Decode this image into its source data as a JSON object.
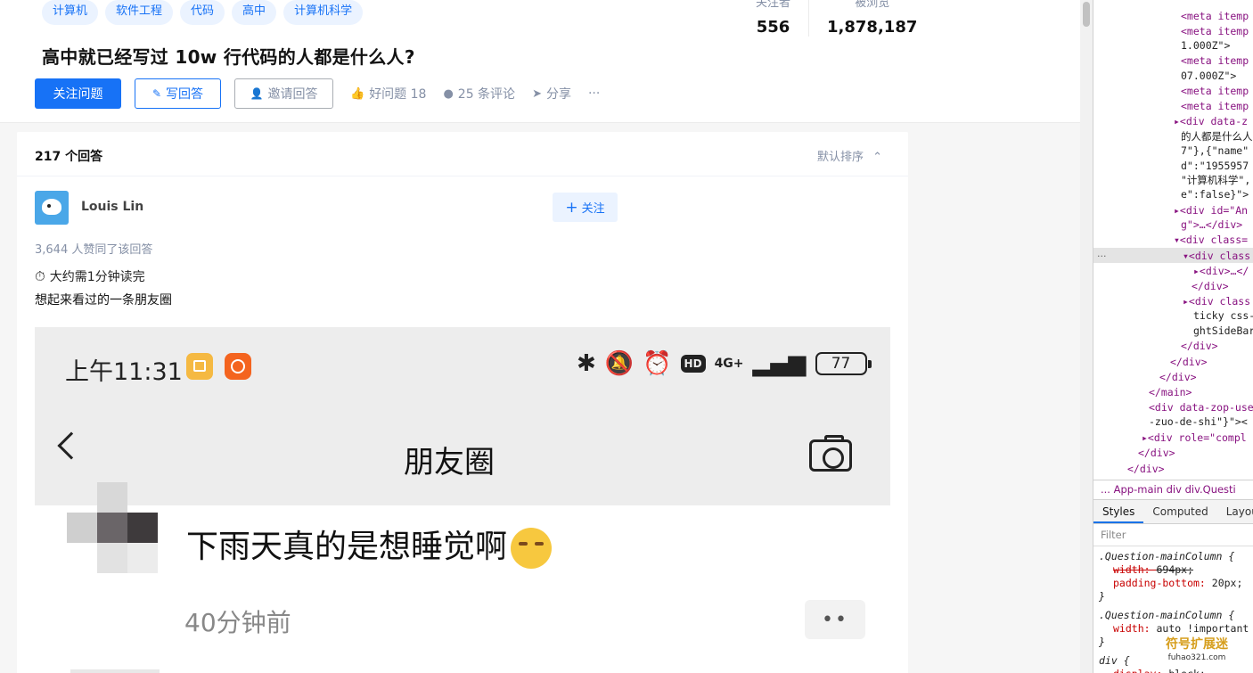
{
  "question": {
    "topics": [
      "计算机",
      "软件工程",
      "代码",
      "高中",
      "计算机科学"
    ],
    "title": "高中就已经写过 10w 行代码的人都是什么人?",
    "stats": [
      {
        "label": "关注者",
        "value": "556"
      },
      {
        "label": "被浏览",
        "value": "1,878,187"
      }
    ],
    "actions": {
      "follow_question": "关注问题",
      "write_answer": "写回答",
      "invite": "邀请回答",
      "good_question": "好问题 18",
      "comments": "25 条评论",
      "share": "分享",
      "more": "···"
    }
  },
  "answers": {
    "count_label": "217 个回答",
    "sort_label": "默认排序",
    "answer": {
      "author": "Louis Lin",
      "follow_label": "关注",
      "votes_text": "3,644 人赞同了该回答",
      "read_time": "大约需1分钟读完",
      "paragraph": "想起来看过的一条朋友圈"
    }
  },
  "embedded_screenshot": {
    "time": "上午11:31",
    "network": "4G+",
    "hd": "HD",
    "battery": "77",
    "page_title": "朋友圈",
    "post_text": "下雨天真的是想睡觉啊",
    "post_time": "40分钟前",
    "more_dots": "••"
  },
  "devtools": {
    "dom_lines": [
      {
        "text": "<meta itemp",
        "kind": "tag"
      },
      {
        "text": "<meta itemp",
        "kind": "tag"
      },
      {
        "text": "1.000Z\">",
        "kind": "text"
      },
      {
        "text": "<meta itemp",
        "kind": "tag"
      },
      {
        "text": "07.000Z\">",
        "kind": "text"
      },
      {
        "text": "<meta itemp",
        "kind": "tag"
      },
      {
        "text": "<meta itemp",
        "kind": "tag"
      },
      {
        "text": "▸<div data-z",
        "kind": "tag"
      },
      {
        "text": "的人都是什么人",
        "kind": "text"
      },
      {
        "text": "7\"},{\"name\"",
        "kind": "text"
      },
      {
        "text": "d\":\"1955957",
        "kind": "text"
      },
      {
        "text": "\"计算机科学\",",
        "kind": "text"
      },
      {
        "text": "e\":false}\">",
        "kind": "text"
      },
      {
        "text": "▸<div id=\"An",
        "kind": "tag"
      },
      {
        "text": "g\">…</div>",
        "kind": "tag"
      },
      {
        "text": "▾<div class=",
        "kind": "tag"
      },
      {
        "text": "▾<div class",
        "kind": "tag"
      },
      {
        "text": "▸<div>…</",
        "kind": "tag"
      },
      {
        "text": "</div>",
        "kind": "tag"
      },
      {
        "text": "▸<div class",
        "kind": "tag"
      },
      {
        "text": "ticky css-",
        "kind": "text"
      },
      {
        "text": "ghtSideBar",
        "kind": "text"
      },
      {
        "text": "</div>",
        "kind": "tag"
      },
      {
        "text": "</div>",
        "kind": "tag"
      },
      {
        "text": "</div>",
        "kind": "tag"
      },
      {
        "text": "</main>",
        "kind": "tag"
      },
      {
        "text": "<div data-zop-use",
        "kind": "tag"
      },
      {
        "text": "-zuo-de-shi\"}\"><",
        "kind": "text"
      },
      {
        "text": "▸<div role=\"compl",
        "kind": "tag"
      },
      {
        "text": "</div>",
        "kind": "tag"
      },
      {
        "text": "</div>",
        "kind": "tag"
      }
    ],
    "selected_marker": "...",
    "breadcrumbs": "...  App-main   div   div.Questi",
    "tabs": [
      "Styles",
      "Computed",
      "Layout"
    ],
    "filter_placeholder": "Filter",
    "rules": [
      {
        "selector": ".Question-mainColumn {",
        "decls": [
          {
            "prop": "width",
            "value": "694px;",
            "struck": true
          },
          {
            "prop": "padding-bottom",
            "value": "20px;",
            "struck": false
          }
        ]
      },
      {
        "selector": ".Question-mainColumn {",
        "decls": [
          {
            "prop": "width",
            "value": "auto !important",
            "struck": false
          }
        ]
      },
      {
        "selector": "div {",
        "decls": [
          {
            "prop": "display",
            "value": "block;",
            "struck": false
          }
        ]
      }
    ]
  },
  "watermark": {
    "text": "符号扩展迷",
    "sub": "fuhao321.com"
  },
  "colors": {
    "accent": "#1772f6",
    "muted": "#8590a6",
    "background": "#f6f6f6"
  }
}
